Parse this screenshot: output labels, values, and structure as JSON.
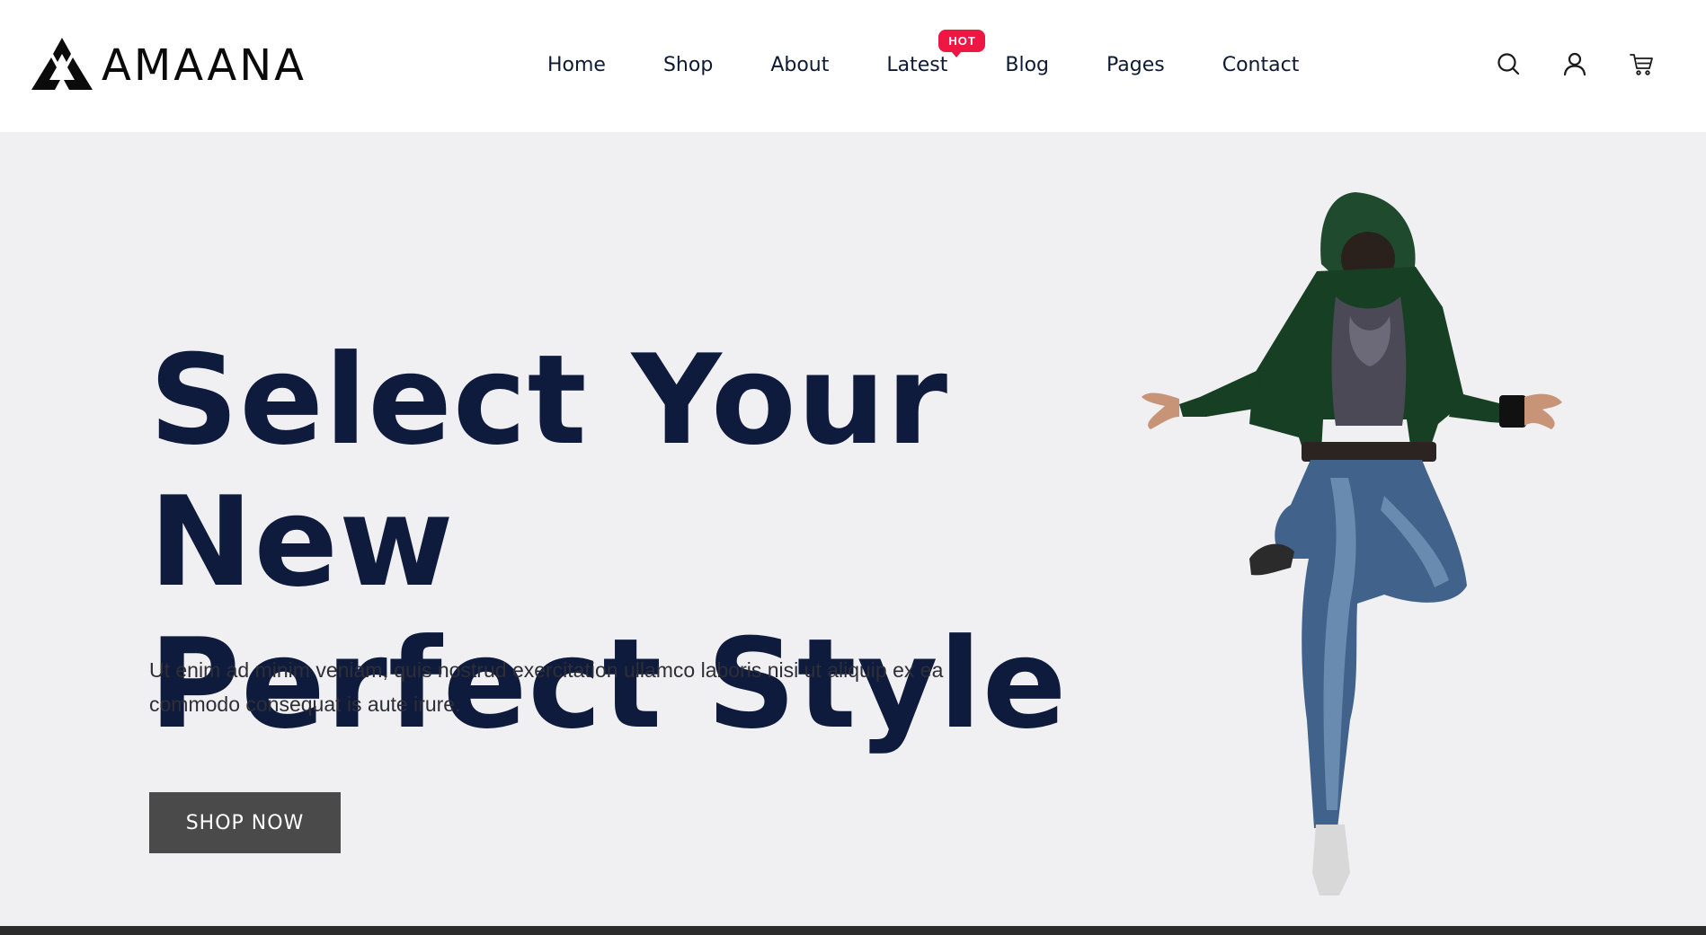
{
  "brand": {
    "name": "AMAANA"
  },
  "nav": {
    "items": [
      {
        "label": "Home"
      },
      {
        "label": "Shop"
      },
      {
        "label": "About"
      },
      {
        "label": "Latest",
        "badge": "HOT"
      },
      {
        "label": "Blog"
      },
      {
        "label": "Pages"
      },
      {
        "label": "Contact"
      }
    ]
  },
  "header_icons": [
    "search-icon",
    "user-icon",
    "cart-icon"
  ],
  "hero": {
    "headline_line1": "Select Your New",
    "headline_line2": "Perfect Style",
    "subtext": "Ut enim ad minim veniam, quis nostrud exercitation ullamco laboris nisi ut aliquip ex ea commodo consequat is aute irure.",
    "cta_label": "SHOP NOW"
  },
  "colors": {
    "heading": "#0e1b3d",
    "hero_bg": "#f0eff2",
    "badge": "#ee1744",
    "button": "#4a4a4a"
  }
}
